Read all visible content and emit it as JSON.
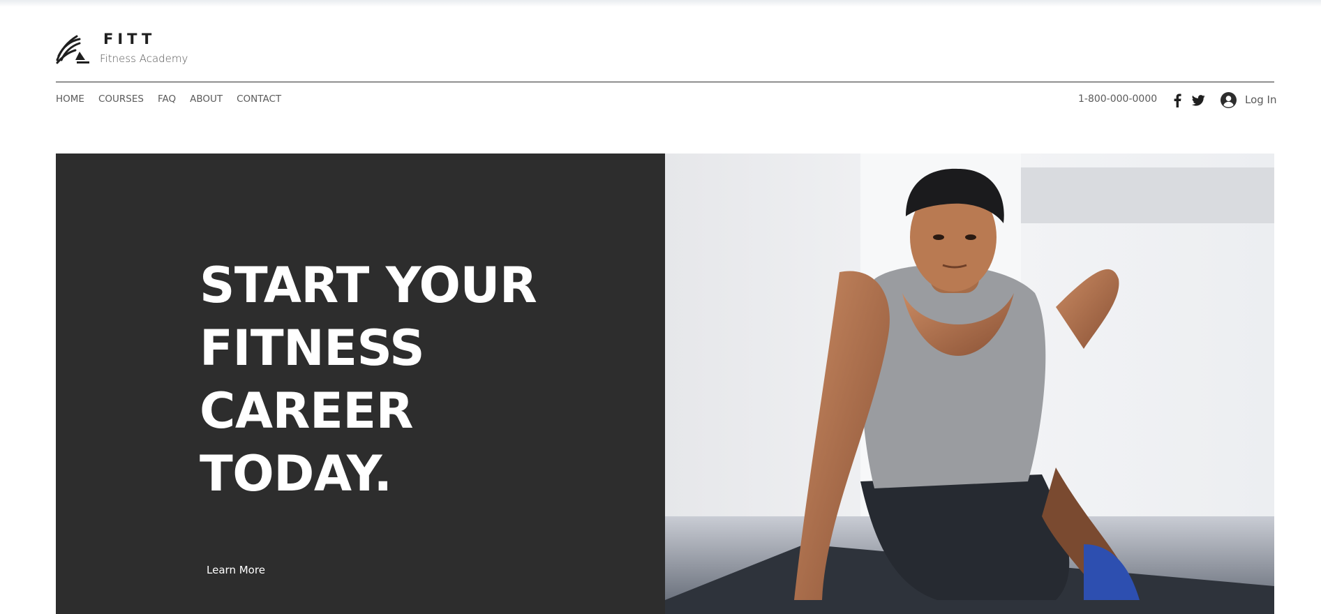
{
  "header": {
    "brand_name": "FITT",
    "brand_tagline": "Fitness Academy",
    "logo_icon": "stacked-stripes-logo-icon"
  },
  "nav": {
    "items": [
      {
        "label": "HOME"
      },
      {
        "label": "COURSES"
      },
      {
        "label": "FAQ"
      },
      {
        "label": "ABOUT"
      },
      {
        "label": "CONTACT"
      }
    ]
  },
  "contact": {
    "phone": "1-800-000-0000"
  },
  "social": {
    "facebook_icon": "facebook-icon",
    "twitter_icon": "twitter-icon"
  },
  "auth": {
    "avatar_icon": "user-avatar-icon",
    "login_label": "Log In"
  },
  "hero": {
    "headline_lines": [
      "START YOUR",
      "FITNESS",
      "CAREER",
      "TODAY."
    ],
    "cta_label": "Learn More",
    "image_subject": "athlete-pushup-photo"
  },
  "colors": {
    "hero_panel": "#2d2d2d",
    "text_dark": "#2d2d2d",
    "nav_text": "#5a5a5a",
    "white": "#ffffff"
  }
}
